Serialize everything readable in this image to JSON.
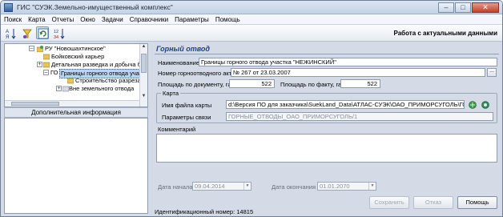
{
  "window": {
    "title": "ГИС \"СУЭК.Земельно-имущественный комплекс\"",
    "minimize_symbol": "–",
    "maximize_symbol": "□",
    "close_symbol": "✕"
  },
  "menu": [
    "Поиск",
    "Карта",
    "Отчеты",
    "Окно",
    "Задачи",
    "Справочники",
    "Параметры",
    "Помощь"
  ],
  "toolbar": {
    "icons": [
      "sort-az-icon",
      "filter-icon",
      "refresh-icon",
      "sort-numeric-icon"
    ],
    "mode_label": "Работа с актуальными данными"
  },
  "tree": {
    "items": [
      {
        "expander": "–",
        "label": "РУ \"Новошахтинское\""
      },
      {
        "expander": "",
        "label": "Бойковский карьер"
      },
      {
        "expander": "+",
        "label": "Детальная разведка и добыча бд"
      },
      {
        "expander": "–",
        "prefix": "ГО",
        "label": "Границы горного отвода участ"
      },
      {
        "expander": "",
        "label": "Строительство разреза по"
      },
      {
        "expander": "+",
        "label": "Вне земельного отвода"
      }
    ]
  },
  "extra_info": {
    "header": "Дополнительная информация"
  },
  "form": {
    "section_title": "Горный отвод",
    "name_label": "Наименование",
    "name_value": "Границы горного отвода участка \"НЕЖИНСКИЙ\"",
    "act_label": "Номер горноотводного акта",
    "act_value": "№ 267 от 23.03.2007",
    "act_button": "...",
    "area_doc_label": "Площадь по документу, га",
    "area_doc_value": "522",
    "area_fact_label": "Площадь по факту, га",
    "area_fact_value": "522",
    "map_group_label": "Карта",
    "map_file_label": "Имя файла карты",
    "map_file_value": "d:\\Версия ПО для заказчика\\SuekLand_Data\\АТЛАС-СУЭК\\ОАО_ПРИМОРСУГОЛЬ\\ГОРНЫЕ_",
    "link_params_label": "Параметры связи",
    "link_params_value": "ГОРНЫЕ_ОТВОДЫ_ОАО_ПРИМОРСУГОЛЬ/1",
    "comment_label": "Комментарий",
    "comment_value": "",
    "date_start_label": "Дата начала",
    "date_start_value": "09.04.2014",
    "date_end_label": "Дата окончания",
    "date_end_value": "01.01.2070"
  },
  "buttons": {
    "save": "Сохранить",
    "cancel": "Отказ",
    "help": "Помощь"
  },
  "footer": {
    "id_text": "Идентификационный номер: 14815"
  },
  "colors": {
    "section_title": "#1f3f8f",
    "selection": "#b9d4f0",
    "window_bg": "#d4dbe6"
  }
}
